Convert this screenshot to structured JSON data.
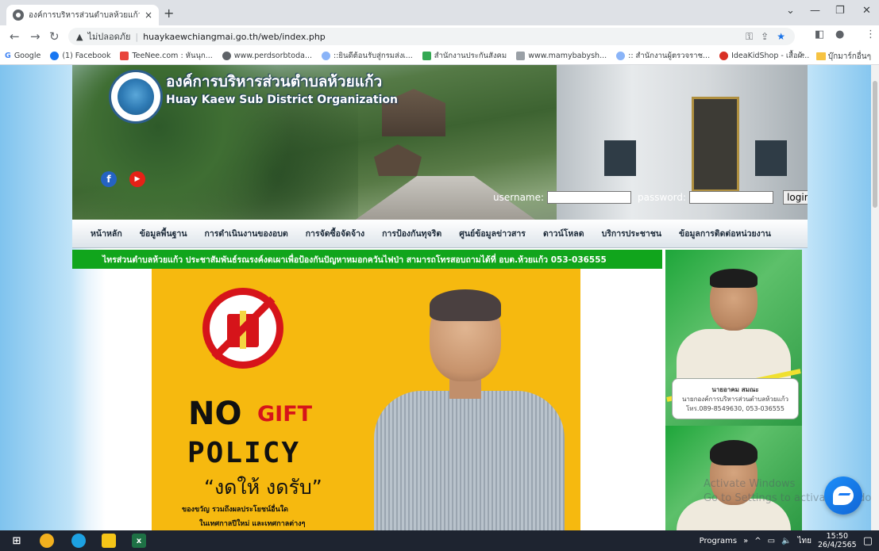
{
  "browser": {
    "tab_title": "องค์การบริหารส่วนตำบลห้วยแก้ว อำเภ",
    "tab_close": "×",
    "new_tab": "+",
    "insecure_label": "ไม่ปลอดภัย",
    "url": "huaykaewchiangmai.go.th/web/index.php",
    "bookmarks": [
      "Google",
      "(1) Facebook",
      "TeeNee.com : หันนุก...",
      "www.perdsorbtoda...",
      "::ยินดีต้อนรับสู่กรมส่งเ...",
      "สำนักงานประกันสังคม",
      "www.mamybabysh...",
      ":: สำนักงานผู้ตรวจราช...",
      "IdeaKidShop - เสื้อผ้..."
    ],
    "bookmark_more": "»",
    "other_bookmarks": "บุ๊กมาร์กอื่นๆ"
  },
  "site": {
    "title_th": "องค์การบริหารส่วนตำบลห้วยแก้ว",
    "title_en": "Huay Kaew Sub District Organization",
    "login": {
      "username_label": "username:",
      "password_label": "password:",
      "button": "login"
    },
    "menu": [
      "หน้าหลัก",
      "ข้อมูลพื้นฐาน",
      "การดำเนินงานของอบต",
      "การจัดซื้อจัดจ้าง",
      "การป้องกันทุจริต",
      "ศูนย์ข้อมูลข่าวสาร",
      "ดาวน์โหลด",
      "บริการประชาชน",
      "ข้อมูลการติดต่อหน่วยงาน"
    ],
    "marquee": "ไทรส่วนตำบลห้วยแก้ว ประชาสัมพันธ์รณรงค์งดเผาเพื่อป้องกันปัญหาหมอกควันไฟป่า สามารถโทรสอบถามได้ที่ อบต.ห้วยแก้ว 053-036555",
    "poster": {
      "no": "NO",
      "gift": "GIFT",
      "policy": "POLICY",
      "slogan": "“งดให้ งดรับ”",
      "sub1": "ของขวัญ รวมถึงผลประโยชน์อื่นใด",
      "sub2": "ในเทศกาลปีใหม่ และเทศกาลต่างๆ"
    },
    "official": {
      "name": "นายอาคม สมณะ",
      "position": "นายกองค์การบริหารส่วนตำบลห้วยแก้ว",
      "phone": "โทร.089-8549630, 053-036555"
    },
    "watermark_line1": "Activate Windows",
    "watermark_line2": "Go to Settings to activate Windows."
  },
  "taskbar": {
    "programs": "Programs",
    "lang": "ไทย",
    "time": "15:50",
    "date": "26/4/2565"
  },
  "colors": {
    "marquee_bg": "#11a51c",
    "poster_bg": "#f6b90f",
    "nogift_red": "#d6141a",
    "card_green": "#1ea63a"
  }
}
